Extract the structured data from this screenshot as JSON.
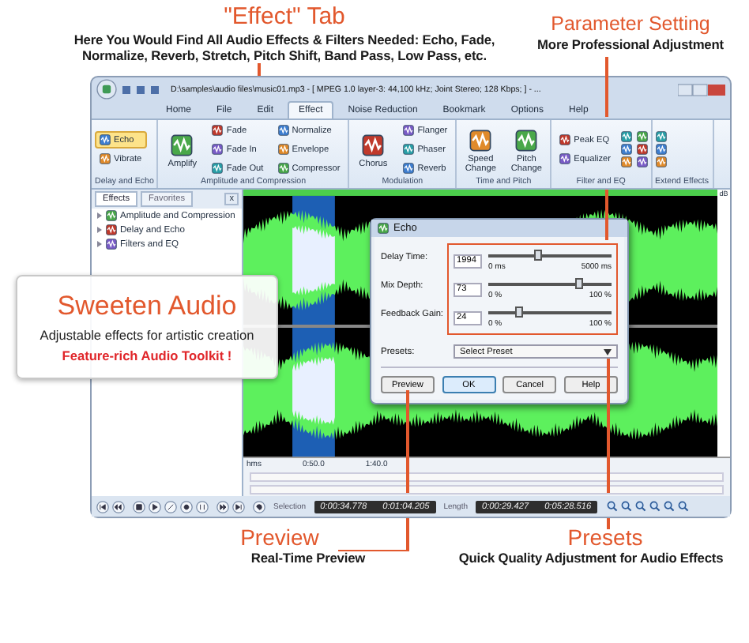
{
  "effect_tab_callout": {
    "title": "\"Effect\" Tab",
    "lines": [
      "Here You Would Find All Audio Effects & Filters Needed: Echo, Fade,",
      "Normalize, Reverb, Stretch, Pitch Shift, Band Pass, Low Pass, etc."
    ]
  },
  "parameter_callout": {
    "title": "Parameter Setting",
    "subtitle": "More Professional Adjustment"
  },
  "window": {
    "title": "D:\\samples\\audio files\\music01.mp3 - [ MPEG 1.0 layer-3: 44,100 kHz; Joint Stereo; 128 Kbps; ] - ...",
    "tabs": [
      {
        "label": "Home",
        "selected": false
      },
      {
        "label": "File",
        "selected": false
      },
      {
        "label": "Edit",
        "selected": false
      },
      {
        "label": "Effect",
        "selected": true
      },
      {
        "label": "Noise Reduction",
        "selected": false
      },
      {
        "label": "Bookmark",
        "selected": false
      },
      {
        "label": "Options",
        "selected": false
      },
      {
        "label": "Help",
        "selected": false
      }
    ],
    "ribbon": [
      {
        "label": "Delay and Echo",
        "columns": [
          [
            {
              "kind": "small",
              "label": "Echo",
              "selected": true
            },
            {
              "kind": "small",
              "label": "Vibrate",
              "selected": false
            }
          ]
        ]
      },
      {
        "label": "Amplitude and Compression",
        "columns": [
          [
            {
              "kind": "large",
              "label": "Amplify",
              "selected": false
            }
          ],
          [
            {
              "kind": "small",
              "label": "Fade",
              "selected": false
            },
            {
              "kind": "small",
              "label": "Fade In",
              "selected": false
            },
            {
              "kind": "small",
              "label": "Fade Out",
              "selected": false
            }
          ],
          [
            {
              "kind": "small",
              "label": "Normalize",
              "selected": false
            },
            {
              "kind": "small",
              "label": "Envelope",
              "selected": false
            },
            {
              "kind": "small",
              "label": "Compressor",
              "selected": false
            }
          ]
        ]
      },
      {
        "label": "Modulation",
        "columns": [
          [
            {
              "kind": "large",
              "label": "Chorus",
              "selected": false
            }
          ],
          [
            {
              "kind": "small",
              "label": "Flanger",
              "selected": false
            },
            {
              "kind": "small",
              "label": "Phaser",
              "selected": false
            },
            {
              "kind": "small",
              "label": "Reverb",
              "selected": false
            }
          ]
        ]
      },
      {
        "label": "Time and Pitch",
        "columns": [
          [
            {
              "kind": "large",
              "label": "Speed Change",
              "selected": false
            }
          ],
          [
            {
              "kind": "large",
              "label": "Pitch Change",
              "selected": false
            }
          ]
        ]
      },
      {
        "label": "Filter and EQ",
        "columns": [
          [
            {
              "kind": "small",
              "label": "Peak EQ",
              "selected": false
            },
            {
              "kind": "small",
              "label": "Equalizer",
              "selected": false
            }
          ],
          [
            {
              "kind": "icon"
            },
            {
              "kind": "icon"
            },
            {
              "kind": "icon"
            }
          ],
          [
            {
              "kind": "icon"
            },
            {
              "kind": "icon"
            },
            {
              "kind": "icon"
            }
          ]
        ]
      },
      {
        "label": "Extend Effects",
        "columns": [
          [
            {
              "kind": "icon"
            },
            {
              "kind": "icon"
            },
            {
              "kind": "icon"
            }
          ]
        ]
      }
    ],
    "effects_panel": {
      "tabs": [
        {
          "label": "Effects",
          "selected": true
        },
        {
          "label": "Favorites",
          "selected": false
        }
      ],
      "close": "x",
      "items": [
        "Amplitude and Compression",
        "Delay and Echo",
        "Filters and EQ"
      ]
    },
    "waveform": {
      "unit": "dB",
      "ruler": [
        "hms",
        "0:50.0",
        "1:40.0"
      ]
    },
    "status": {
      "selection_label": "Selection",
      "selection": [
        "0:00:34.778",
        "0:01:04.205"
      ],
      "length_label": "Length",
      "length": [
        "0:00:29.427",
        "0:05:28.516"
      ]
    }
  },
  "echo_dialog": {
    "title": "Echo",
    "params": [
      {
        "label": "Delay Time:",
        "value": "1994",
        "level": 0.4,
        "min": "0 ms",
        "max": "5000 ms"
      },
      {
        "label": "Mix Depth:",
        "value": "73",
        "level": 0.73,
        "min": "0 %",
        "max": "100 %"
      },
      {
        "label": "Feedback Gain:",
        "value": "24",
        "level": 0.24,
        "min": "0 %",
        "max": "100 %"
      }
    ],
    "presets_label": "Presets:",
    "preset": "Select Preset",
    "buttons": [
      {
        "label": "Preview",
        "default": false
      },
      {
        "label": "OK",
        "default": true
      },
      {
        "label": "Cancel",
        "default": false
      },
      {
        "label": "Help",
        "default": false
      }
    ]
  },
  "sweeten_box": {
    "title": "Sweeten Audio",
    "subtitle": "Adjustable effects for artistic creation",
    "tagline": "Feature-rich Audio Toolkit !"
  },
  "preview_callout": {
    "title": "Preview",
    "subtitle": "Real-Time Preview"
  },
  "presets_callout": {
    "title": "Presets",
    "subtitle": "Quick Quality Adjustment for Audio Effects"
  }
}
